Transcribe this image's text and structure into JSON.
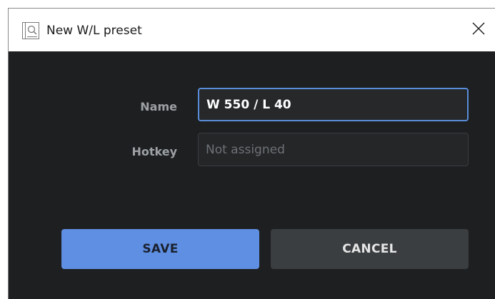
{
  "dialog": {
    "title": "New W/L preset",
    "close_icon": "close-icon",
    "app_icon": "preset-window-icon"
  },
  "form": {
    "name_label": "Name",
    "name_value": "W 550 / L 40",
    "hotkey_label": "Hotkey",
    "hotkey_placeholder": "Not assigned"
  },
  "buttons": {
    "save_label": "SAVE",
    "cancel_label": "CANCEL"
  },
  "colors": {
    "background": "#1d1f21",
    "accent": "#5f8fe3",
    "focus_border": "#5a8dd9",
    "secondary_button": "#3b3e41"
  }
}
